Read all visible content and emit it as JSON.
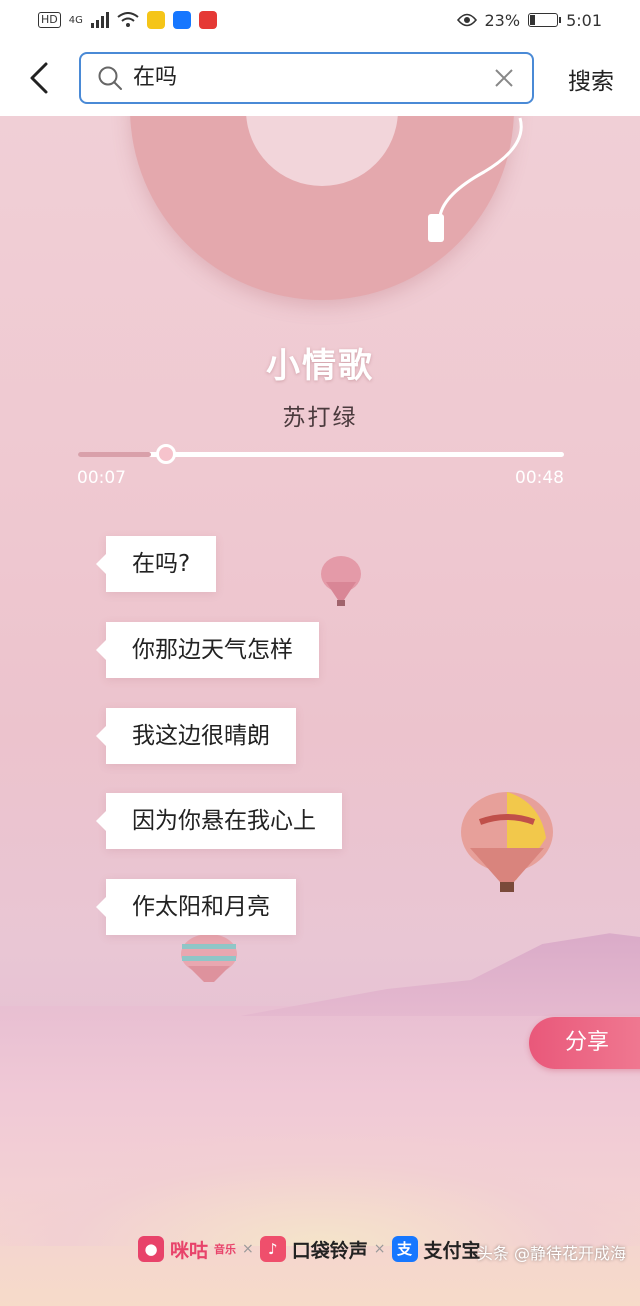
{
  "status_bar": {
    "hd_label": "HD",
    "network": "4G",
    "battery_percent": "23%",
    "battery_level": 0.23,
    "time": "5:01"
  },
  "search": {
    "query": "在吗",
    "action_label": "搜索"
  },
  "player": {
    "title": "小情歌",
    "artist": "苏打绿",
    "current_time": "00:07",
    "total_time": "00:48",
    "progress": 0.15
  },
  "lyrics": [
    "在吗?",
    "你那边天气怎样",
    "我这边很晴朗",
    "因为你悬在我心上",
    "作太阳和月亮"
  ],
  "share_label": "分享",
  "partners": {
    "migu": "咪咕",
    "migu_sub": "音乐",
    "pocket": "口袋铃声",
    "alipay": "支付宝",
    "sep": "×"
  },
  "watermark": "头条 @静待花开成海",
  "colors": {
    "accent_blue": "#4a8ad6",
    "share_pink": "#e9587a"
  }
}
